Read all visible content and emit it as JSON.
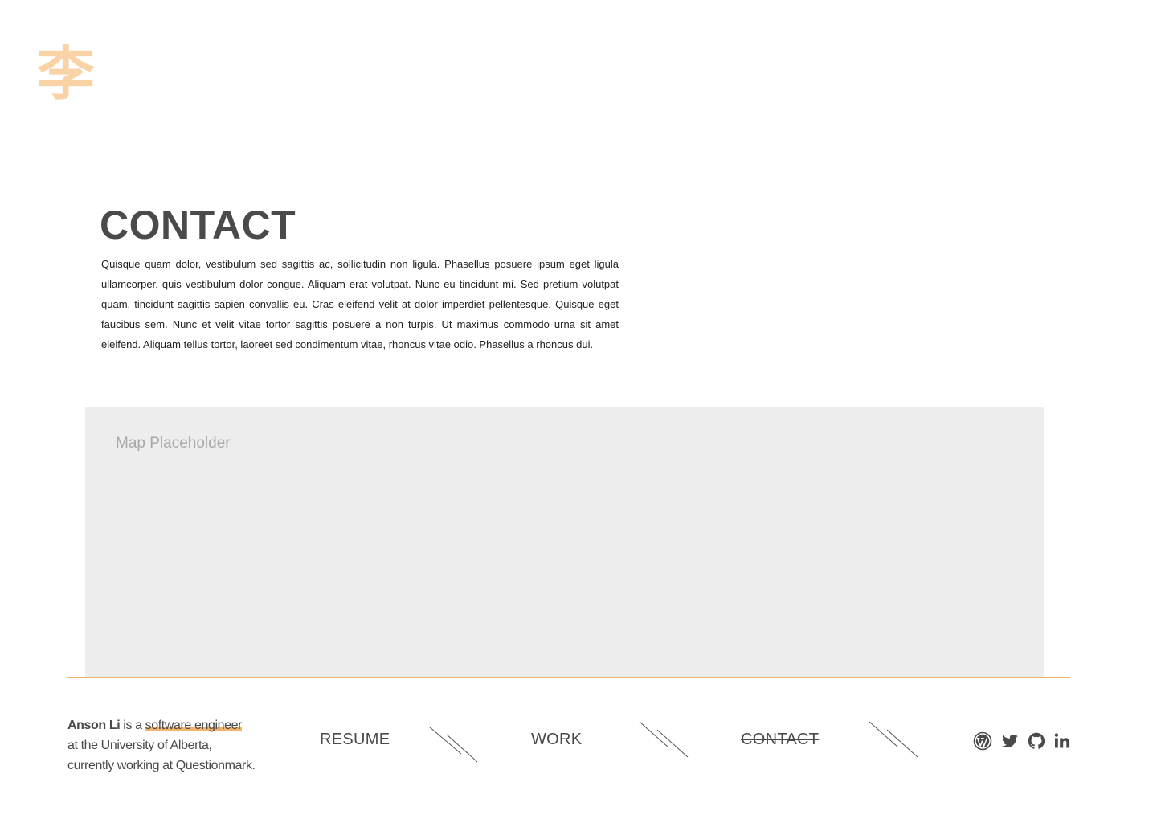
{
  "logo": {
    "character": "李",
    "color": "#f9d3a5"
  },
  "page": {
    "title": "CONTACT",
    "intro": "Quisque quam dolor, vestibulum sed sagittis ac, sollicitudin non ligula. Phasellus posuere ipsum eget ligula ullamcorper, quis vestibulum dolor congue. Aliquam erat volutpat. Nunc eu tincidunt mi. Sed pretium volutpat quam, tincidunt sagittis sapien convallis eu. Cras eleifend velit at dolor imperdiet pellentesque. Quisque eget faucibus sem. Nunc et velit vitae tortor sagittis posuere a non turpis. Ut maximus commodo urna sit amet eleifend. Aliquam tellus tortor, laoreet sed condimentum vitae, rhoncus vitae odio. Phasellus a rhoncus dui."
  },
  "map": {
    "label": "Map Placeholder"
  },
  "footer": {
    "bio": {
      "name": "Anson Li",
      "connector": " is a ",
      "role": "software engineer",
      "line2": "at the University of Alberta,",
      "line3": "currently working at Questionmark."
    },
    "nav": [
      {
        "label": "RESUME",
        "active": false
      },
      {
        "label": "WORK",
        "active": false
      },
      {
        "label": "CONTACT",
        "active": true
      }
    ],
    "social": [
      {
        "icon": "wordpress-icon"
      },
      {
        "icon": "twitter-icon"
      },
      {
        "icon": "github-icon"
      },
      {
        "icon": "linkedin-icon"
      }
    ]
  },
  "colors": {
    "accent": "#f2b46b",
    "text": "#4a4a4a",
    "map_bg": "#ededed",
    "map_text": "#a8a8a8"
  }
}
